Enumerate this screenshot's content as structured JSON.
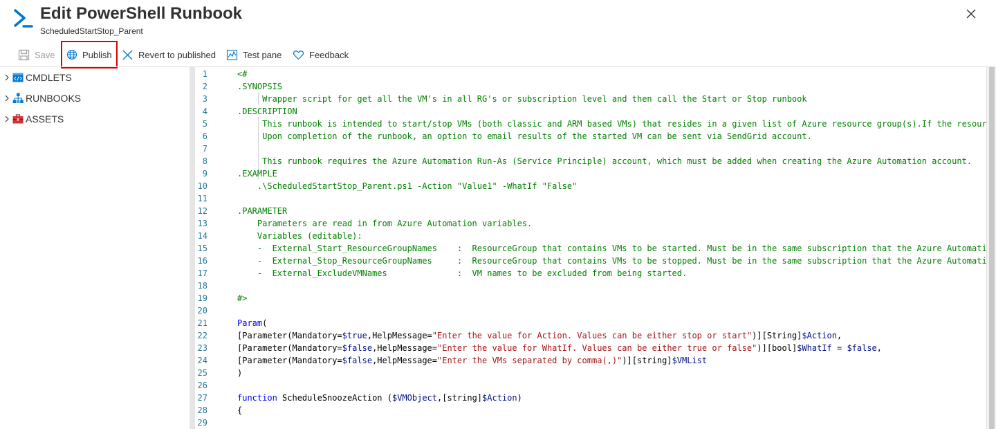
{
  "header": {
    "title": "Edit PowerShell Runbook",
    "subtitle": "ScheduledStartStop_Parent",
    "icon": "powershell-prompt-icon",
    "close_icon": "close-icon"
  },
  "toolbar": {
    "save_label": "Save",
    "publish_label": "Publish",
    "revert_label": "Revert to published",
    "test_label": "Test pane",
    "feedback_label": "Feedback"
  },
  "colors": {
    "accent": "#0078d4",
    "highlight_border": "#e00000",
    "comment": "#008000",
    "keyword": "#0000ff",
    "variable": "#001080",
    "string": "#a31515",
    "line_number": "#237893"
  },
  "sidebar": {
    "items": [
      {
        "label": "CMDLETS",
        "icon": "code-icon"
      },
      {
        "label": "RUNBOOKS",
        "icon": "hierarchy-icon"
      },
      {
        "label": "ASSETS",
        "icon": "toolbox-icon"
      }
    ]
  },
  "editor": {
    "line_numbers": [
      "1",
      "2",
      "3",
      "4",
      "5",
      "6",
      "7",
      "8",
      "9",
      "10",
      "11",
      "12",
      "13",
      "14",
      "15",
      "16",
      "17",
      "18",
      "19",
      "20",
      "21",
      "22",
      "23",
      "24",
      "25",
      "26",
      "27",
      "28",
      "29"
    ],
    "lines": [
      [
        {
          "t": "<#",
          "c": "c"
        }
      ],
      [
        {
          "t": ".SYNOPSIS",
          "c": "c"
        }
      ],
      [
        {
          "t": "     Wrapper script for get all the VM's in all RG's or subscription level and then call the Start or Stop runbook",
          "c": "c"
        }
      ],
      [
        {
          "t": ".DESCRIPTION",
          "c": "c"
        }
      ],
      [
        {
          "t": "     This runbook is intended to start/stop VMs (both classic and ARM based VMs) that resides in a given list of Azure resource group(s).If the resource",
          "c": "c"
        }
      ],
      [
        {
          "t": "     Upon completion of the runbook, an option to email results of the started VM can be sent via SendGrid account.",
          "c": "c"
        }
      ],
      [
        {
          "t": "",
          "c": "c"
        }
      ],
      [
        {
          "t": "     This runbook requires the Azure Automation Run-As (Service Principle) account, which must be added when creating the Azure Automation account.",
          "c": "c"
        }
      ],
      [
        {
          "t": ".EXAMPLE",
          "c": "c"
        }
      ],
      [
        {
          "t": "    .\\ScheduledStartStop_Parent.ps1 -Action \"Value1\" -WhatIf \"False\"",
          "c": "c"
        }
      ],
      [
        {
          "t": "",
          "c": "c"
        }
      ],
      [
        {
          "t": ".PARAMETER",
          "c": "c"
        }
      ],
      [
        {
          "t": "    Parameters are read in from Azure Automation variables.",
          "c": "c"
        }
      ],
      [
        {
          "t": "    Variables (editable):",
          "c": "c"
        }
      ],
      [
        {
          "t": "    -  External_Start_ResourceGroupNames    :  ResourceGroup that contains VMs to be started. Must be in the same subscription that the Azure Automation",
          "c": "c"
        }
      ],
      [
        {
          "t": "    -  External_Stop_ResourceGroupNames     :  ResourceGroup that contains VMs to be stopped. Must be in the same subscription that the Azure Automation",
          "c": "c"
        }
      ],
      [
        {
          "t": "    -  External_ExcludeVMNames              :  VM names to be excluded from being started.",
          "c": "c"
        }
      ],
      [
        {
          "t": "",
          "c": "c"
        }
      ],
      [
        {
          "t": "#>",
          "c": "c"
        }
      ],
      [
        {
          "t": "",
          "c": ""
        }
      ],
      [
        {
          "t": "Param",
          "c": "k"
        },
        {
          "t": "(",
          "c": ""
        }
      ],
      [
        {
          "t": "[Parameter(Mandatory=",
          "c": ""
        },
        {
          "t": "$true",
          "c": "v"
        },
        {
          "t": ",HelpMessage=",
          "c": ""
        },
        {
          "t": "\"Enter the value for Action. Values can be either stop or start\"",
          "c": "s"
        },
        {
          "t": ")][String]",
          "c": ""
        },
        {
          "t": "$Action",
          "c": "v"
        },
        {
          "t": ",",
          "c": ""
        }
      ],
      [
        {
          "t": "[Parameter(Mandatory=",
          "c": ""
        },
        {
          "t": "$false",
          "c": "v"
        },
        {
          "t": ",HelpMessage=",
          "c": ""
        },
        {
          "t": "\"Enter the value for WhatIf. Values can be either true or false\"",
          "c": "s"
        },
        {
          "t": ")][bool]",
          "c": ""
        },
        {
          "t": "$WhatIf",
          "c": "v"
        },
        {
          "t": " = ",
          "c": ""
        },
        {
          "t": "$false",
          "c": "v"
        },
        {
          "t": ",",
          "c": ""
        }
      ],
      [
        {
          "t": "[Parameter(Mandatory=",
          "c": ""
        },
        {
          "t": "$false",
          "c": "v"
        },
        {
          "t": ",HelpMessage=",
          "c": ""
        },
        {
          "t": "\"Enter the VMs separated by comma(,)\"",
          "c": "s"
        },
        {
          "t": ")][string]",
          "c": ""
        },
        {
          "t": "$VMList",
          "c": "v"
        }
      ],
      [
        {
          "t": ")",
          "c": ""
        }
      ],
      [
        {
          "t": "",
          "c": ""
        }
      ],
      [
        {
          "t": "function",
          "c": "k"
        },
        {
          "t": " ScheduleSnoozeAction (",
          "c": ""
        },
        {
          "t": "$VMObject",
          "c": "v"
        },
        {
          "t": ",[string]",
          "c": ""
        },
        {
          "t": "$Action",
          "c": "v"
        },
        {
          "t": ")",
          "c": ""
        }
      ],
      [
        {
          "t": "{",
          "c": ""
        }
      ],
      [
        {
          "t": "",
          "c": ""
        }
      ]
    ]
  }
}
